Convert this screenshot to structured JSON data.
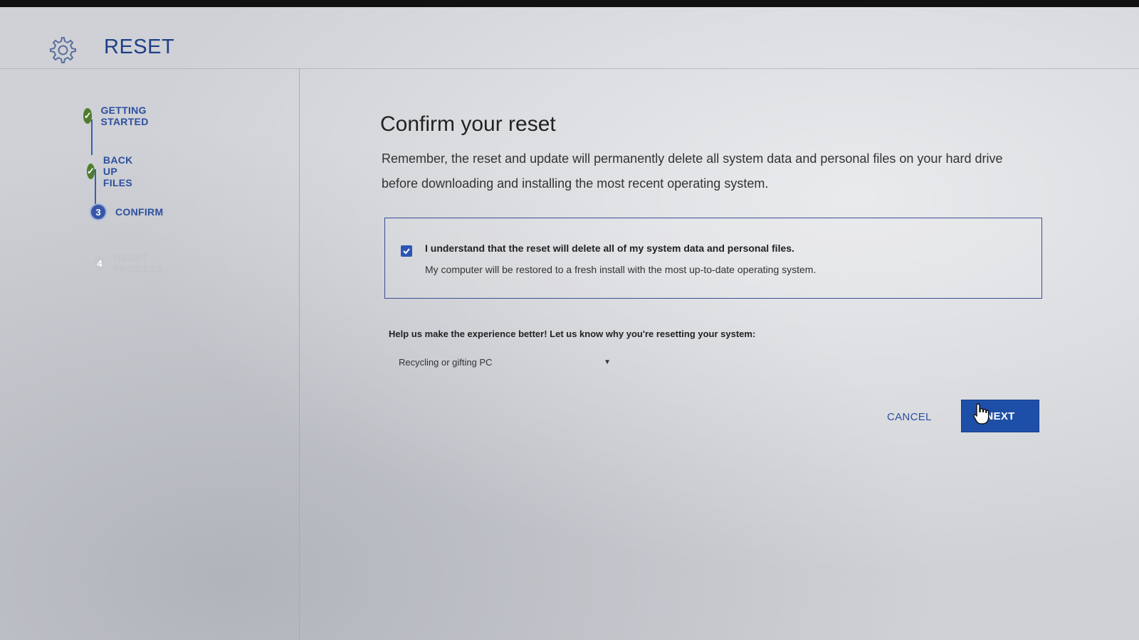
{
  "header": {
    "title": "RESET",
    "icon": "gear-icon"
  },
  "steps": [
    {
      "label": "GETTING STARTED",
      "state": "done",
      "icon": "check-icon"
    },
    {
      "label": "BACK UP FILES",
      "state": "done",
      "icon": "check-icon"
    },
    {
      "label": "CONFIRM",
      "state": "current",
      "number": "3"
    },
    {
      "label": "RESET PROCESS",
      "state": "pending",
      "number": "4"
    }
  ],
  "main": {
    "title": "Confirm your reset",
    "description": "Remember, the reset and update will permanently delete all system data and personal files on your hard drive before downloading and installing the most recent operating system.",
    "confirm": {
      "checked": true,
      "label": "I understand that the reset will delete all of my system data and personal files.",
      "sublabel": "My computer will be restored to a fresh install with the most up-to-date operating system."
    },
    "feedback": {
      "label": "Help us make the experience better! Let us know why you're resetting your system:",
      "selected": "Recycling or gifting PC"
    },
    "actions": {
      "cancel": "CANCEL",
      "next": "NEXT"
    }
  },
  "colors": {
    "accent": "#1e4fa8",
    "done": "#4f7d2c",
    "text_link": "#2c4f9e"
  }
}
